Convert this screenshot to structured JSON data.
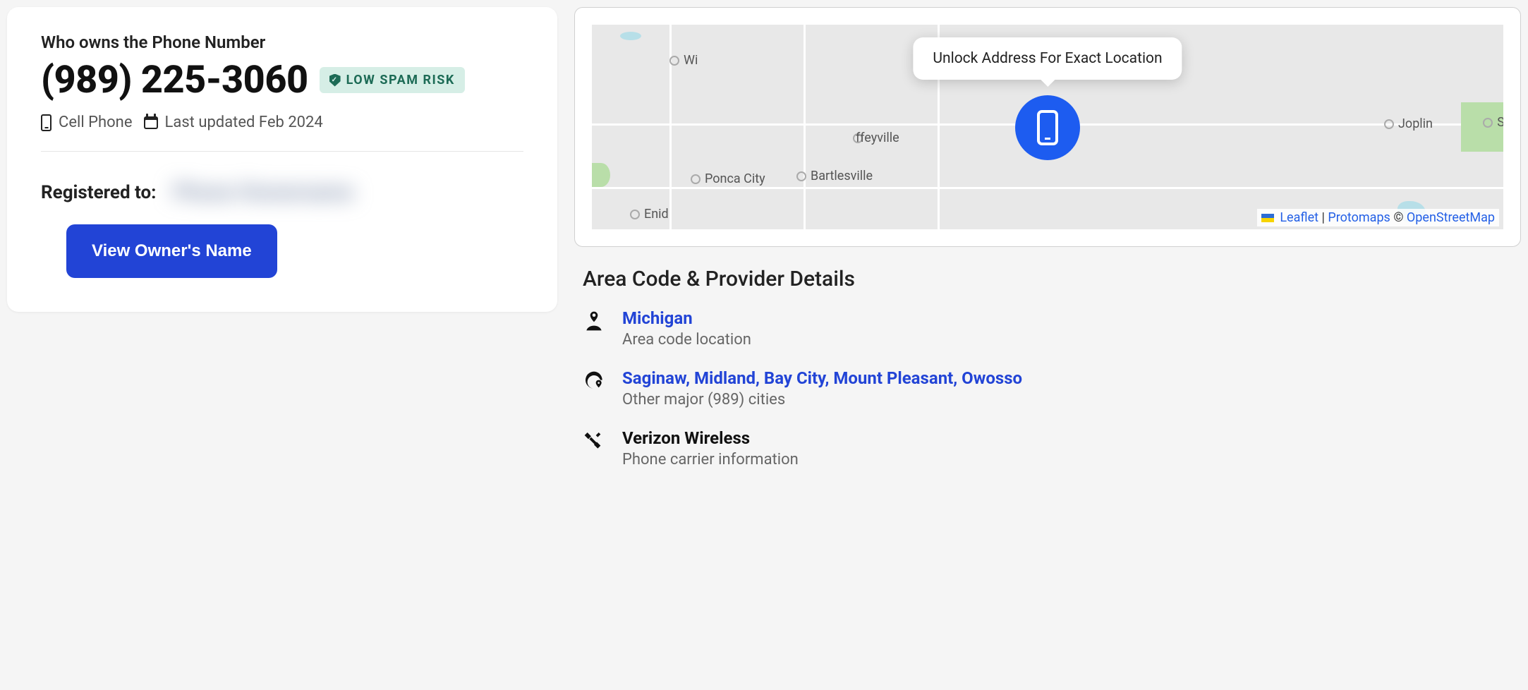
{
  "phone": {
    "subtitle": "Who owns the Phone Number",
    "number": "(989) 225-3060",
    "spam_badge": "LOW SPAM RISK",
    "type": "Cell Phone",
    "last_updated": "Last updated Feb 2024",
    "registered_label": "Registered to:",
    "blurred_placeholder": "Phone Ownername",
    "view_button": "View Owner's Name"
  },
  "map": {
    "tooltip": "Unlock Address For Exact Location",
    "cities": {
      "wichita_partial": "Wi",
      "coffeyville_partial": "ffeyville",
      "joplin": "Joplin",
      "sp_partial": "Sp",
      "ponca": "Ponca City",
      "bartlesville": "Bartlesville",
      "enid": "Enid"
    },
    "attribution": {
      "leaflet": "Leaflet",
      "sep": " | ",
      "protomaps": "Protomaps",
      "copyright": " © ",
      "osm": "OpenStreetMap"
    }
  },
  "details": {
    "heading": "Area Code & Provider Details",
    "location": {
      "title": "Michigan",
      "sub": "Area code location"
    },
    "cities": {
      "title": "Saginaw, Midland, Bay City, Mount Pleasant, Owosso",
      "sub": "Other major (989) cities"
    },
    "carrier": {
      "title": "Verizon Wireless",
      "sub": "Phone carrier information"
    }
  }
}
